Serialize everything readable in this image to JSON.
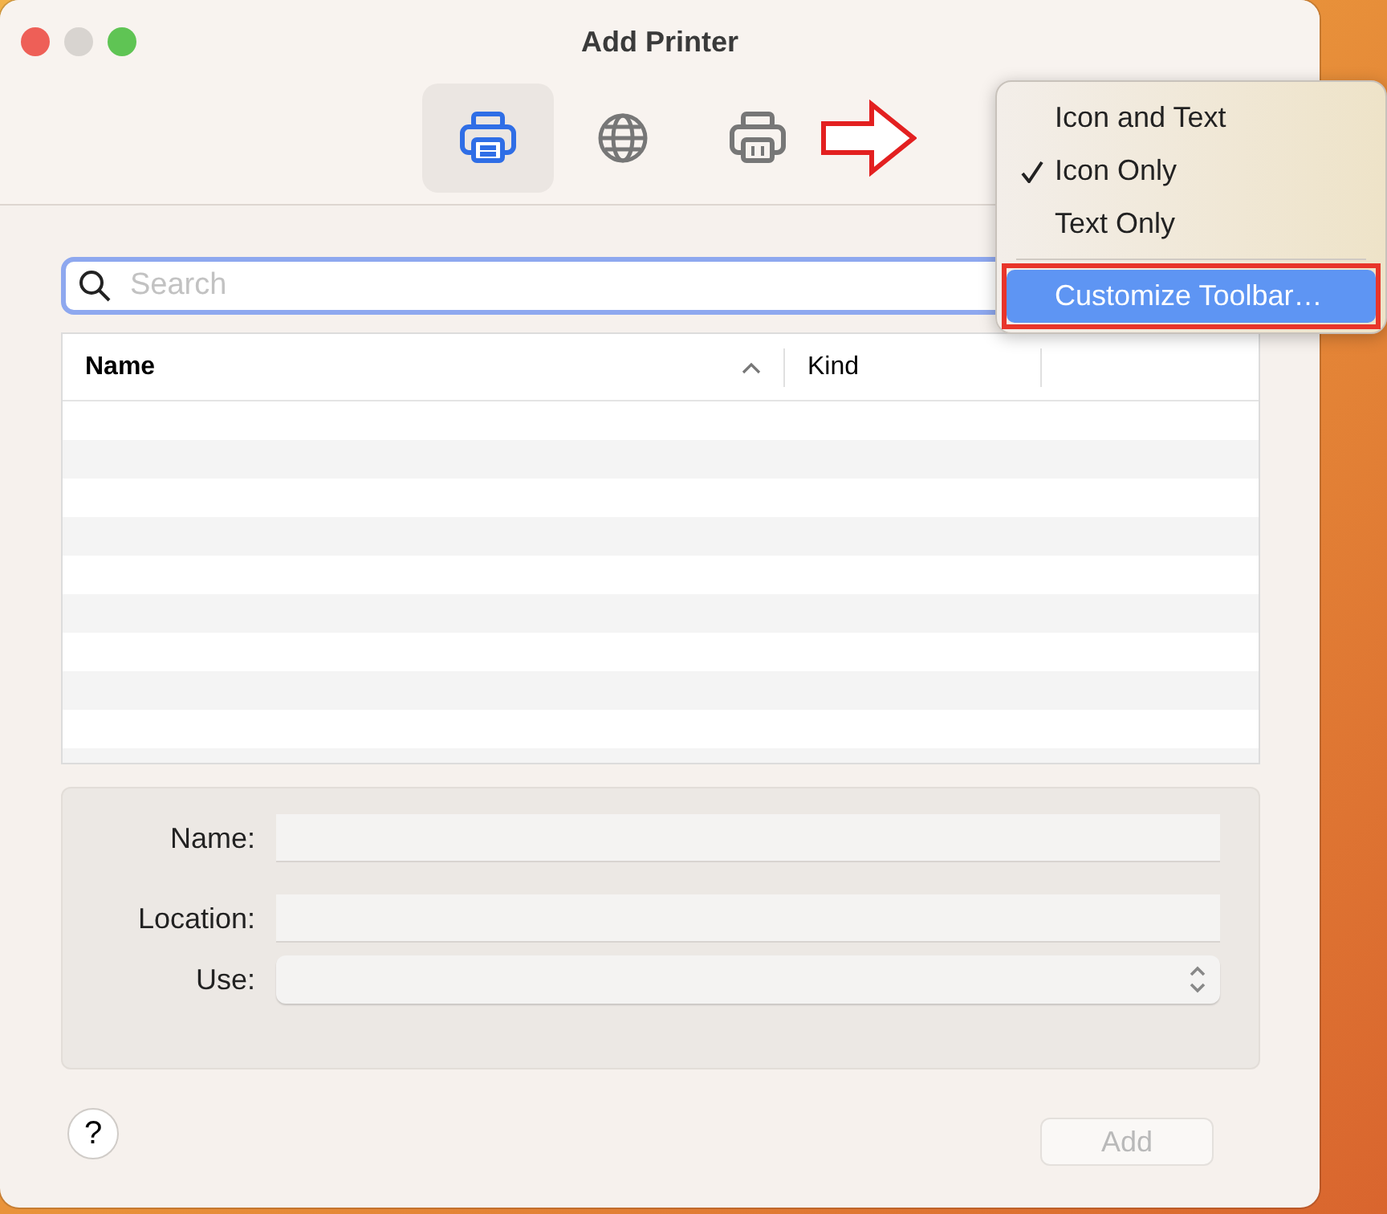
{
  "window": {
    "title": "Add Printer"
  },
  "toolbar": {
    "items": [
      {
        "kind": "printer",
        "selected": true
      },
      {
        "kind": "globe",
        "selected": false
      },
      {
        "kind": "fax",
        "selected": false
      }
    ]
  },
  "search": {
    "placeholder": "Search"
  },
  "table": {
    "columns": [
      {
        "label": "Name",
        "sorted": true
      },
      {
        "label": "Kind",
        "sorted": false
      }
    ]
  },
  "form": {
    "fields": [
      {
        "label": "Name:",
        "kind": "text"
      },
      {
        "label": "Location:",
        "kind": "text"
      },
      {
        "label": "Use:",
        "kind": "select"
      }
    ]
  },
  "help_button": {
    "label": "?"
  },
  "add_button": {
    "label": "Add",
    "disabled": true
  },
  "context_menu": {
    "items": [
      {
        "label": "Icon and Text",
        "checked": false,
        "selected": false
      },
      {
        "label": "Icon Only",
        "checked": true,
        "selected": false
      },
      {
        "label": "Text Only",
        "checked": false,
        "selected": false
      },
      {
        "label": "Customize Toolbar…",
        "checked": false,
        "selected": true,
        "separator_before": true
      }
    ]
  }
}
